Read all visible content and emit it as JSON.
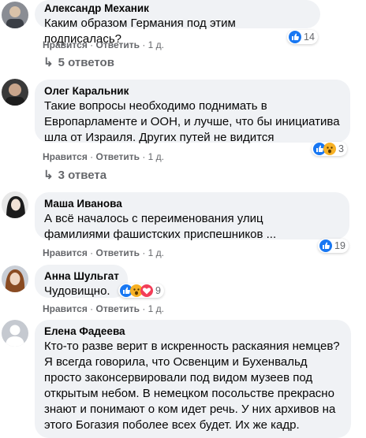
{
  "actions": {
    "like": "Нравится",
    "reply": "Ответить",
    "time": "1 д.",
    "sep": "·"
  },
  "comments": [
    {
      "author": "Александр Механик",
      "text": "Каким образом Германия под этим подписалась?",
      "reactions": "14"
    },
    {
      "author": "Олег Карaльник",
      "text": "Такие вопросы необходимо поднимать в Европарламенте и ООН, и лучше, что бы инициатива шла от Израиля. Других путей не видится",
      "reactions": "3"
    },
    {
      "author": "Маша Иванова",
      "text": "А всё началось с переименования улиц фамилиями фашистских приспешников ...",
      "reactions": "19"
    },
    {
      "author": "Анна Шульгат",
      "text": "Чудовищно.",
      "reactions": "9"
    },
    {
      "author": "Елена Фадеева",
      "text": "Кто-то разве верит в искренность раскаяния немцев? Я всегда говорила, что Освенцим и Бухенвальд просто законсервировали под видом музеев под открытым небом. В немецком посольстве прекрасно знают и понимают о ком идет речь. У них архивов на этого Богазия поболее всех будет. Их же кадр."
    }
  ],
  "replies": [
    "5 ответов",
    "3 ответа"
  ],
  "colors": {
    "link": "#65676b",
    "bubble": "#f0f2f5",
    "like": "#1877f2"
  }
}
